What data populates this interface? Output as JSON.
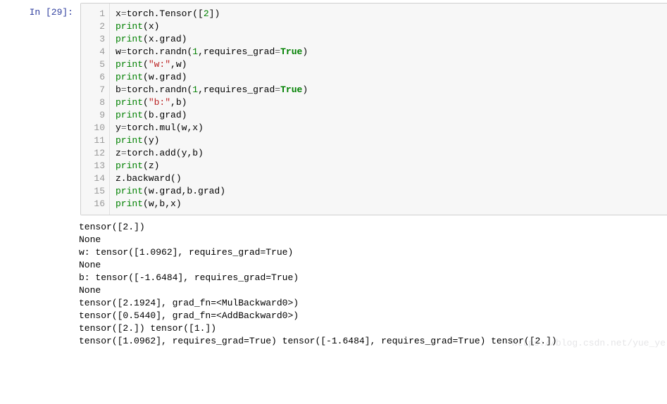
{
  "prompt": {
    "label": "In  [29]:"
  },
  "code": {
    "lines": [
      {
        "n": "1",
        "html": "x<span class='c-op'>=</span>torch.Tensor([<span class='c-num'>2</span>])"
      },
      {
        "n": "2",
        "html": "<span class='c-fn'>print</span>(x)"
      },
      {
        "n": "3",
        "html": "<span class='c-fn'>print</span>(x.grad)"
      },
      {
        "n": "4",
        "html": "w<span class='c-op'>=</span>torch.randn(<span class='c-num'>1</span>,requires_grad<span class='c-op'>=</span><span class='c-kw'>True</span>)"
      },
      {
        "n": "5",
        "html": "<span class='c-fn'>print</span>(<span class='c-str'>\"w:\"</span>,w)"
      },
      {
        "n": "6",
        "html": "<span class='c-fn'>print</span>(w.grad)"
      },
      {
        "n": "7",
        "html": "b<span class='c-op'>=</span>torch.randn(<span class='c-num'>1</span>,requires_grad<span class='c-op'>=</span><span class='c-kw'>True</span>)"
      },
      {
        "n": "8",
        "html": "<span class='c-fn'>print</span>(<span class='c-str'>\"b:\"</span>,b)"
      },
      {
        "n": "9",
        "html": "<span class='c-fn'>print</span>(b.grad)"
      },
      {
        "n": "10",
        "html": "y<span class='c-op'>=</span>torch.mul(w,x)"
      },
      {
        "n": "11",
        "html": "<span class='c-fn'>print</span>(y)"
      },
      {
        "n": "12",
        "html": "z<span class='c-op'>=</span>torch.add(y,b)"
      },
      {
        "n": "13",
        "html": "<span class='c-fn'>print</span>(z)"
      },
      {
        "n": "14",
        "html": "z.backward()"
      },
      {
        "n": "15",
        "html": "<span class='c-fn'>print</span>(w.grad,b.grad)"
      },
      {
        "n": "16",
        "html": "<span class='c-fn'>print</span>(w,b,x)"
      }
    ]
  },
  "output": {
    "lines": [
      "tensor([2.])",
      "None",
      "w: tensor([1.0962], requires_grad=True)",
      "None",
      "b: tensor([-1.6484], requires_grad=True)",
      "None",
      "tensor([2.1924], grad_fn=<MulBackward0>)",
      "tensor([0.5440], grad_fn=<AddBackward0>)",
      "tensor([2.]) tensor([1.])",
      "tensor([1.0962], requires_grad=True) tensor([-1.6484], requires_grad=True) tensor([2.])"
    ]
  },
  "watermark": "https://blog.csdn.net/yue_ye"
}
